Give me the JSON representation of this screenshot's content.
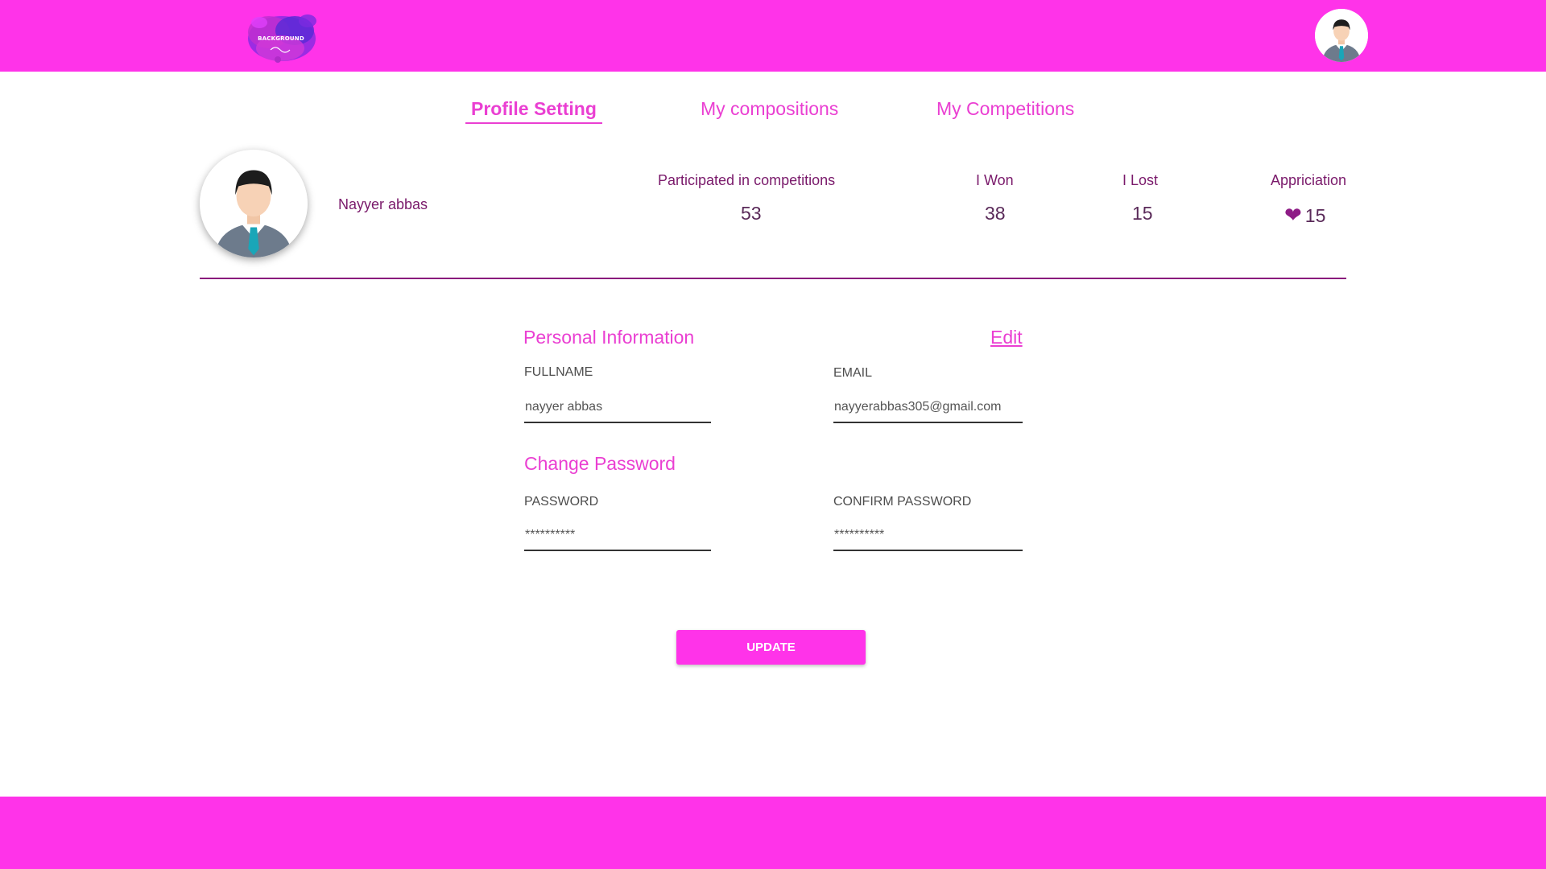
{
  "header": {
    "logo_text": "BACKGROUND",
    "logo_icon": "paint-splash-logo",
    "avatar_icon": "user-avatar-icon"
  },
  "tabs": [
    {
      "label": "Profile Setting",
      "active": true
    },
    {
      "label": "My compositions",
      "active": false
    },
    {
      "label": "My Competitions",
      "active": false
    }
  ],
  "profile": {
    "name": "Nayyer abbas",
    "avatar_icon": "user-avatar-icon"
  },
  "stats": {
    "participated": {
      "label": "Participated in competitions",
      "value": "53"
    },
    "won": {
      "label": "I Won",
      "value": "38"
    },
    "lost": {
      "label": "I Lost",
      "value": "15"
    },
    "appreciation": {
      "label": "Appriciation",
      "value": "15",
      "icon": "heart-icon"
    }
  },
  "personal_info": {
    "title": "Personal Information",
    "edit_label": "Edit",
    "fullname_label": "FULLNAME",
    "fullname_value": "nayyer abbas",
    "email_label": "EMAIL",
    "email_value": "nayyerabbas305@gmail.com"
  },
  "change_password": {
    "title": "Change Password",
    "password_label": "PASSWORD",
    "password_value": "**********",
    "confirm_label": "CONFIRM PASSWORD",
    "confirm_value": "**********"
  },
  "actions": {
    "update_label": "UPDATE"
  },
  "colors": {
    "brand": "#ff33e9",
    "accent_text": "#ea3fd2",
    "dark_text": "#7a1a6b"
  }
}
